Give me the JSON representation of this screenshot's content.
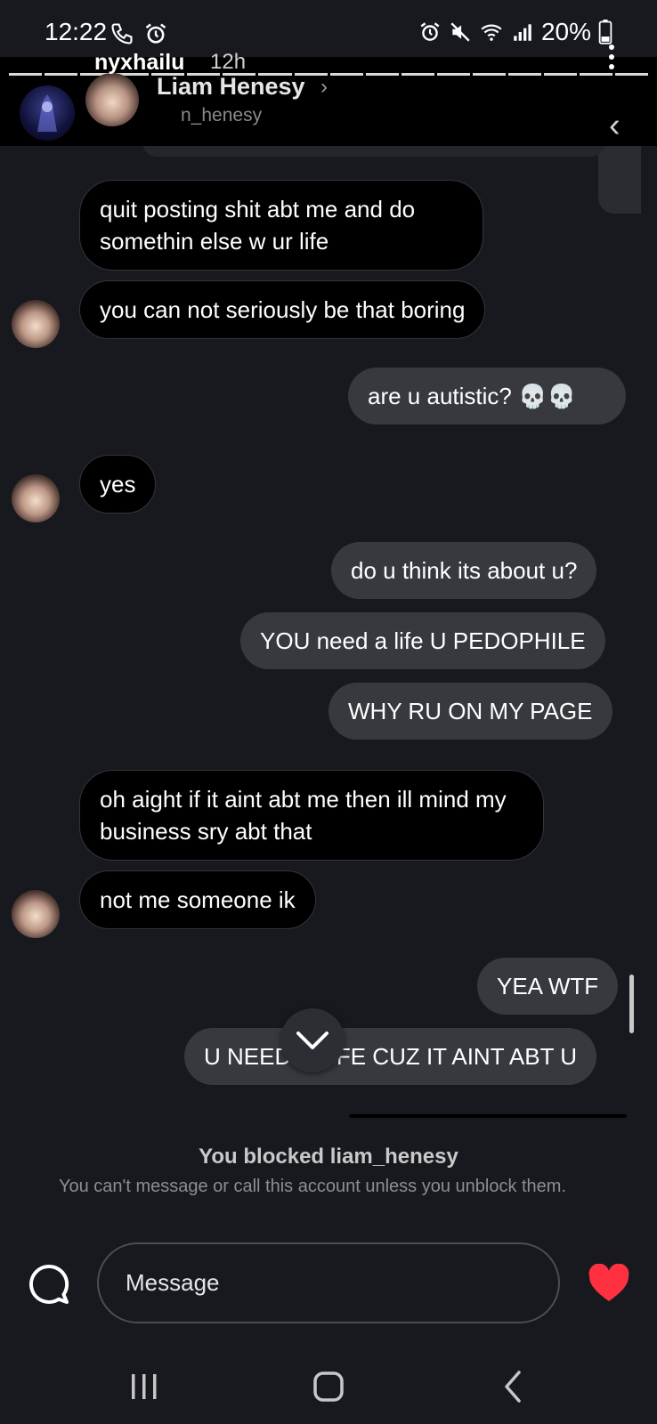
{
  "status_bar": {
    "time": "12:22",
    "battery_text": "20%",
    "left_icons": [
      "phone-call-icon",
      "alarm-icon"
    ],
    "right_icons": [
      "alarm-icon",
      "mute-icon",
      "wifi-icon",
      "signal-icon",
      "battery-icon"
    ]
  },
  "story_overlay": {
    "username": "nyxhailu",
    "time_ago": "12h",
    "progress_segments": 18
  },
  "chat_header": {
    "name": "Liam Henesy",
    "handle_partial": "n_henesy"
  },
  "messages": [
    {
      "side": "in",
      "text": "quit posting shit abt me and do somethin else w ur life",
      "avatar": false
    },
    {
      "side": "in",
      "text": "you can not seriously be that boring",
      "avatar": true
    },
    {
      "side": "out",
      "text": "are u autistic? 💀💀"
    },
    {
      "side": "in",
      "text": "yes",
      "avatar": true
    },
    {
      "side": "out",
      "text": "do u think its about u?"
    },
    {
      "side": "out",
      "text": "YOU need a life U PEDOPHILE"
    },
    {
      "side": "out",
      "text": "WHY RU ON MY PAGE"
    },
    {
      "side": "in",
      "text": "oh aight if it aint abt me then ill mind my business sry abt that",
      "avatar": false
    },
    {
      "side": "in",
      "text": "not me someone ik",
      "avatar": true
    },
    {
      "side": "out",
      "text": "YEA WTF"
    },
    {
      "side": "out",
      "text": "U NEED A LIFE CUZ IT AINT ABT U"
    }
  ],
  "blocked": {
    "title": "You blocked liam_henesy",
    "subtitle": "You can't message or call this account unless you unblock them."
  },
  "composer": {
    "placeholder": "Message"
  },
  "colors": {
    "background": "#17191f",
    "incoming_bubble": "#000000",
    "outgoing_bubble": "#37393f",
    "heart": "#ff3040"
  },
  "nav": [
    "recents-icon",
    "home-icon",
    "back-icon"
  ]
}
